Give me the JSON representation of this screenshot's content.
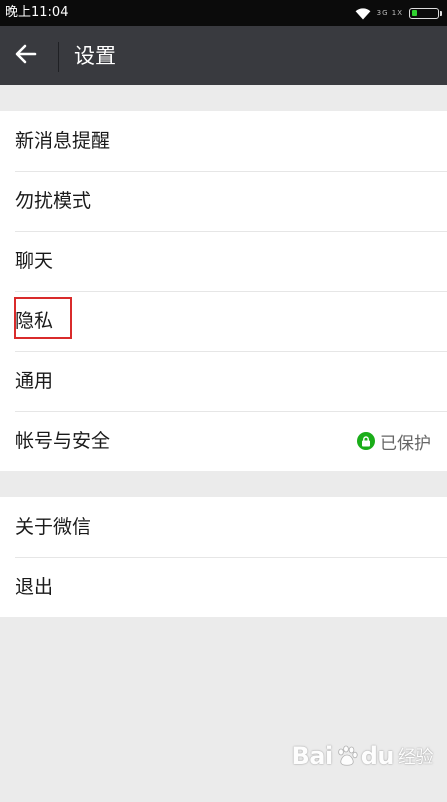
{
  "status_bar": {
    "time": "晚上11:04",
    "signal_text": "3G 1X",
    "battery_color": "#2fd12f"
  },
  "app_bar": {
    "back_icon": "arrow-left-icon",
    "title": "设置",
    "background": "#393a3f"
  },
  "settings": {
    "group1": [
      {
        "label": "新消息提醒"
      },
      {
        "label": "勿扰模式"
      },
      {
        "label": "聊天"
      },
      {
        "label": "隐私"
      },
      {
        "label": "通用"
      },
      {
        "label": "帐号与安全",
        "status": "已保护",
        "status_icon": "lock-icon"
      }
    ],
    "group2": [
      {
        "label": "关于微信"
      },
      {
        "label": "退出"
      }
    ]
  },
  "annotation": {
    "highlight_color": "#d92b2b"
  },
  "watermark": {
    "brand": "Bai",
    "brand_tail": "du",
    "sub": "经验"
  }
}
